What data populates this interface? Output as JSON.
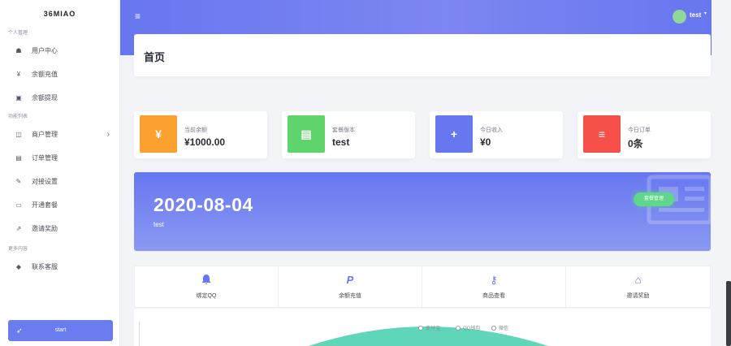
{
  "app": {
    "brand": "36MIAO"
  },
  "sidebar": {
    "sections": [
      {
        "title": "个人管理",
        "items": [
          {
            "icon": "home-icon",
            "glyph": "☗",
            "label": "用户中心"
          },
          {
            "icon": "yen-icon",
            "glyph": "¥",
            "label": "余额充值"
          },
          {
            "icon": "wallet-icon",
            "glyph": "▣",
            "label": "余额提现"
          }
        ]
      },
      {
        "title": "功能列表",
        "items": [
          {
            "icon": "columns-icon",
            "glyph": "◫",
            "label": "商户管理",
            "chevron": "›"
          },
          {
            "icon": "list-icon",
            "glyph": "▤",
            "label": "订单管理"
          },
          {
            "icon": "wrench-icon",
            "glyph": "✎",
            "label": "对接设置"
          },
          {
            "icon": "card-icon",
            "glyph": "▭",
            "label": "开通套餐"
          },
          {
            "icon": "share-icon",
            "glyph": "⇗",
            "label": "邀请奖励"
          }
        ]
      },
      {
        "title": "更多内容",
        "items": [
          {
            "icon": "bell-icon",
            "glyph": "◆",
            "label": "联系客服"
          }
        ]
      }
    ],
    "start_button": {
      "label": "start",
      "glyph": "➶"
    }
  },
  "header": {
    "menu_glyph": "≡",
    "user": "test",
    "caret": "▾"
  },
  "page_title": "首页",
  "stats": [
    {
      "label": "当前余额",
      "value": "¥1000.00",
      "glyph": "¥",
      "color": "#fca030"
    },
    {
      "label": "套餐版本",
      "value": "test",
      "glyph": "▤",
      "color": "#5fd46c"
    },
    {
      "label": "今日收入",
      "value": "¥0",
      "glyph": "+",
      "color": "#6777ef"
    },
    {
      "label": "今日订单",
      "value": "0条",
      "glyph": "≡",
      "color": "#f5504a"
    }
  ],
  "hero": {
    "date": "2020-08-04",
    "subtitle": "test",
    "button": "套餐管理"
  },
  "quick_links": [
    {
      "label": "绑定QQ",
      "glyph": "🔔",
      "icon": "bell-icon"
    },
    {
      "label": "余额充值",
      "glyph": "P",
      "icon": "paypal-icon"
    },
    {
      "label": "商品查看",
      "glyph": "⚷",
      "icon": "key-icon"
    },
    {
      "label": "邀请奖励",
      "glyph": "⌂",
      "icon": "home-icon"
    }
  ],
  "chart": {
    "legend": [
      "支付宝",
      "QQ钱包",
      "微信"
    ],
    "colors": {
      "area": "#5fd6b8"
    }
  },
  "colors": {
    "primary": "#6777ef",
    "start_button": "#6a7cf0",
    "avatar": "#8fd89a"
  }
}
